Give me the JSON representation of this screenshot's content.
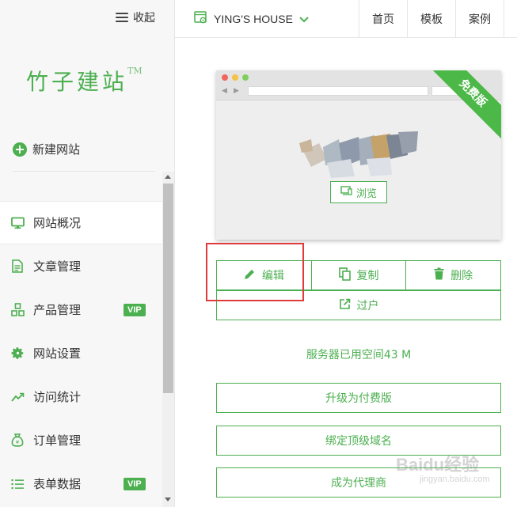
{
  "sidebar": {
    "collapse_label": "收起",
    "logo_text": "竹子建站",
    "logo_tm": "TM",
    "new_site_label": "新建网站",
    "items": [
      {
        "label": "网站概况",
        "icon": "monitor-icon",
        "active": true,
        "vip": false
      },
      {
        "label": "文章管理",
        "icon": "document-icon",
        "active": false,
        "vip": false
      },
      {
        "label": "产品管理",
        "icon": "grid-icon",
        "active": false,
        "vip": true
      },
      {
        "label": "网站设置",
        "icon": "gear-icon",
        "active": false,
        "vip": false
      },
      {
        "label": "访问统计",
        "icon": "trend-icon",
        "active": false,
        "vip": false
      },
      {
        "label": "订单管理",
        "icon": "moneybag-icon",
        "active": false,
        "vip": false
      },
      {
        "label": "表单数据",
        "icon": "list-icon",
        "active": false,
        "vip": true
      }
    ],
    "vip_label": "VIP"
  },
  "topbar": {
    "site_name": "YING'S HOUSE",
    "nav": [
      "首页",
      "模板",
      "案例"
    ]
  },
  "preview": {
    "ribbon": "免费版",
    "browse_label": "浏览"
  },
  "actions": {
    "edit": "编辑",
    "copy": "复制",
    "delete": "删除",
    "transfer": "过户"
  },
  "storage_text": "服务器已用空间43 M",
  "buttons": {
    "upgrade": "升级为付费版",
    "bind_domain": "绑定顶级域名",
    "agent": "成为代理商"
  },
  "watermark": {
    "main": "Baidu经验",
    "sub": "jingyan.baidu.com"
  },
  "colors": {
    "accent": "#4caf50",
    "highlight": "#e03b3b"
  }
}
